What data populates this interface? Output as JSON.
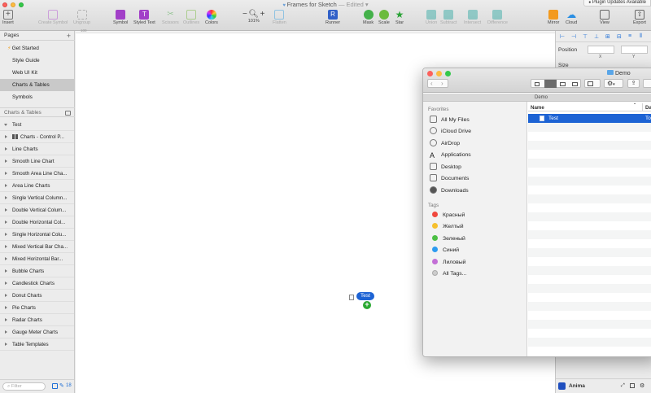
{
  "app": {
    "title": "Frames for Sketch",
    "status": " — Edited",
    "plugin_notice": "Plugin Updates Available"
  },
  "toolbar": {
    "insert": "Insert",
    "create_symbol": "Create Symbol",
    "ungroup": "Ungroup",
    "symbol": "Symbol",
    "styled_text": "Styled Text",
    "scissors": "Scissors",
    "outlines": "Outlines",
    "colors": "Colors",
    "zoom": "101%",
    "flatten": "Flatten",
    "runner": "Runner",
    "mask": "Mask",
    "scale": "Scale",
    "star": "Star",
    "union": "Union",
    "subtract": "Subtract",
    "intersect": "Intersect",
    "difference": "Difference",
    "mirror": "Mirror",
    "cloud": "Cloud",
    "view": "View",
    "export": "Export",
    "ruler_tick": "100"
  },
  "sidebar": {
    "pages_header": "Pages",
    "pages": [
      "Get Started",
      "Style Guide",
      "Web UI Kit",
      "Charts & Tables",
      "Symbols"
    ],
    "selected_page": "Charts & Tables",
    "layers_header": "Charts & Tables",
    "layers": [
      "Test",
      "Charts - Control P...",
      "Line Charts",
      "Smooth Line Chart",
      "Smooth Area Line Cha...",
      "Area Line Charts",
      "Single Vertical Column...",
      "Double Vertical Colum...",
      "Double Horizontal Col...",
      "Single Horizontal Colu...",
      "Mixed Vertical Bar Cha...",
      "Mixed Horizontal Bar...",
      "Bubble Charts",
      "Candlestick Charts",
      "Donut Charts",
      "Pie Charts",
      "Radar Charts",
      "Gauge Meter Charts",
      "Table Templates"
    ],
    "filter_placeholder": "Filter",
    "layer_count": "18"
  },
  "canvas": {
    "dragged_label": "Test"
  },
  "inspector": {
    "position_label": "Position",
    "x_label": "X",
    "y_label": "Y",
    "size_label": "Size",
    "plugin_name": "Anima"
  },
  "finder": {
    "title": "Demo",
    "path_bar": "Demo",
    "favorites_header": "Favorites",
    "favorites": [
      "All My Files",
      "iCloud Drive",
      "AirDrop",
      "Applications",
      "Desktop",
      "Documents",
      "Downloads"
    ],
    "tags_header": "Tags",
    "tags": [
      {
        "name": "Красный",
        "color": "#f0483e"
      },
      {
        "name": "Желтый",
        "color": "#f6c02d"
      },
      {
        "name": "Зеленый",
        "color": "#4cbf44"
      },
      {
        "name": "Синий",
        "color": "#2d9bf0"
      },
      {
        "name": "Лиловый",
        "color": "#c36fd6"
      }
    ],
    "all_tags": "All Tags...",
    "col_name": "Name",
    "col_date": "Da",
    "files": [
      {
        "name": "Test",
        "date": "To"
      }
    ]
  },
  "colors": {
    "accent": "#1f6fd6",
    "selection": "#1d63d4"
  }
}
